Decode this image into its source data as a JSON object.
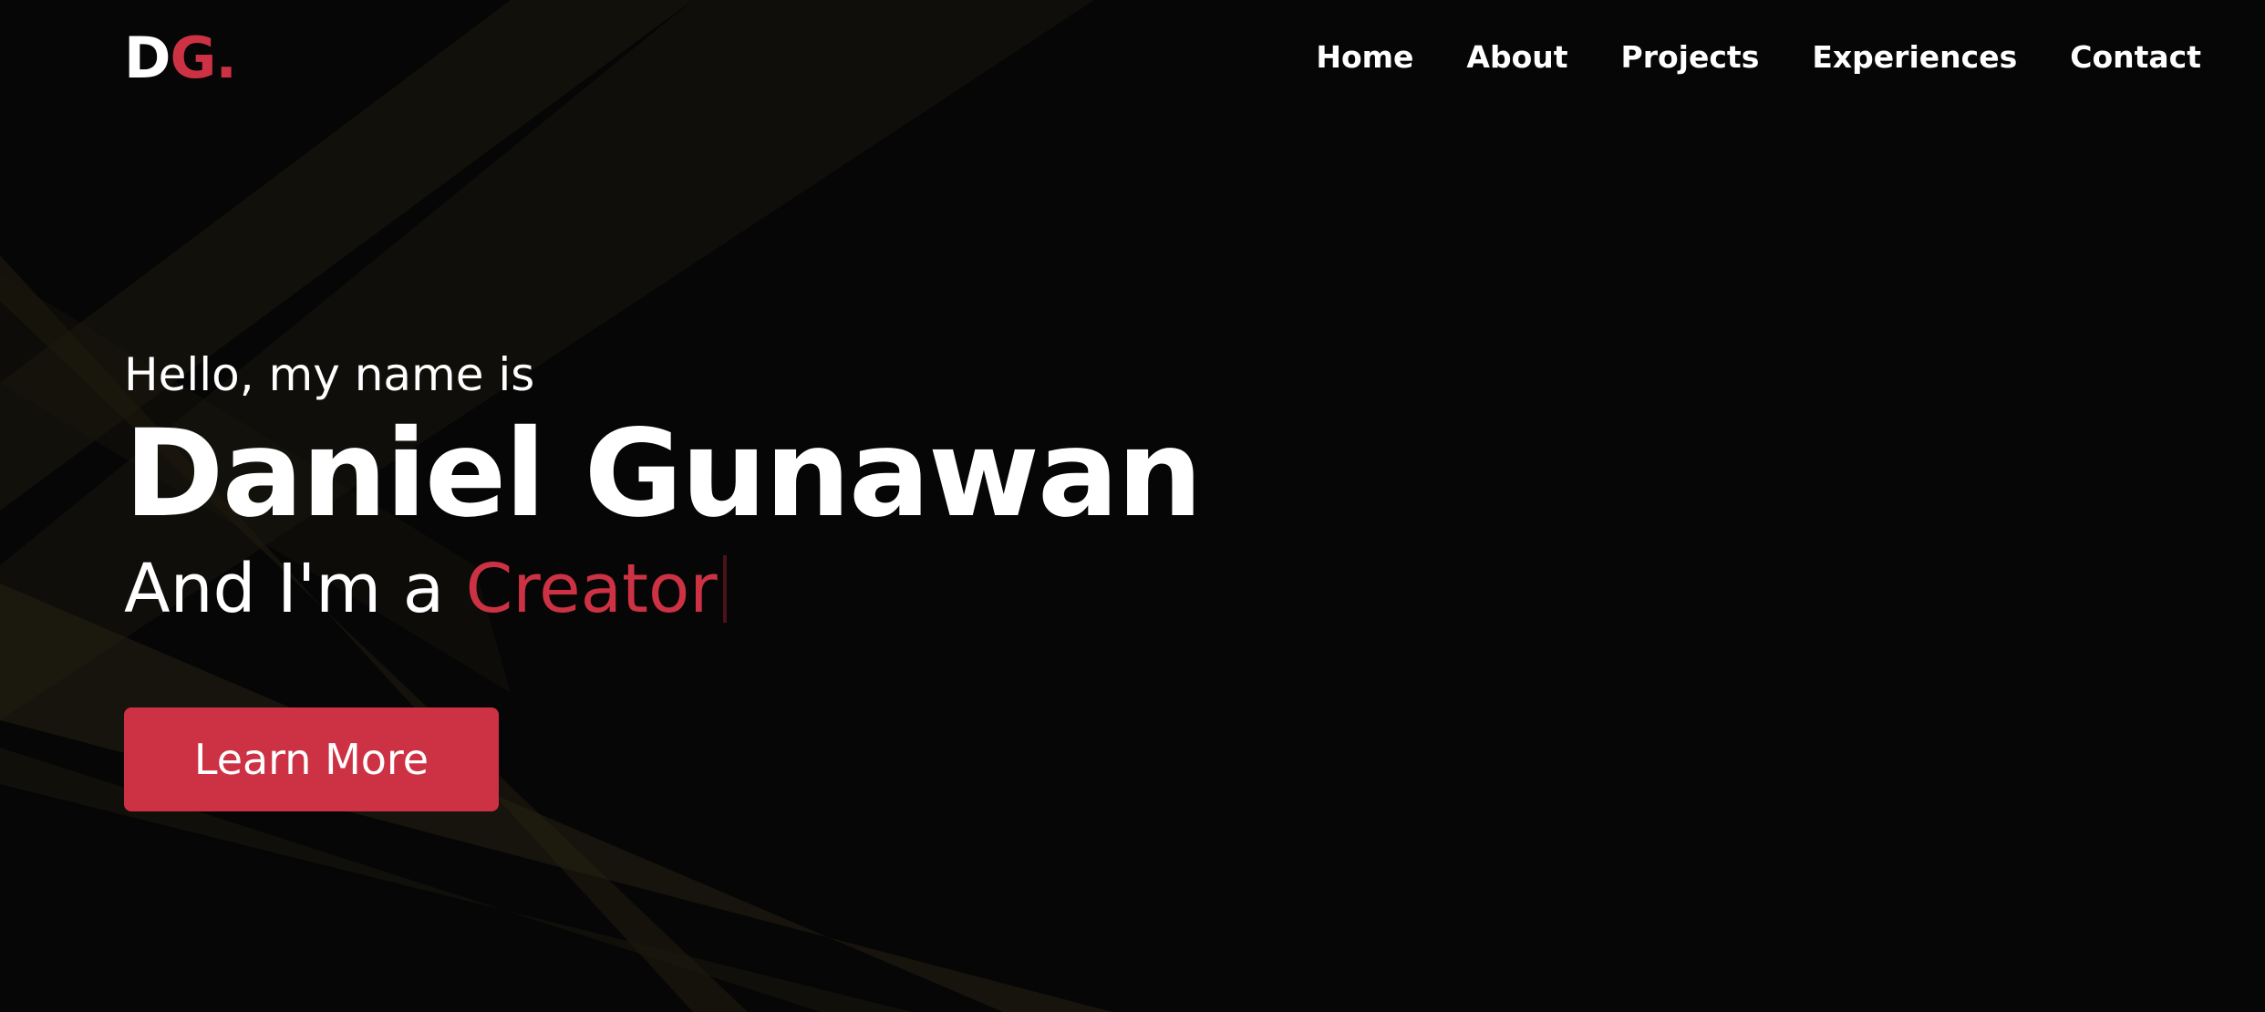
{
  "nav": {
    "logo_main": "D",
    "logo_accent": "G.",
    "items": [
      {
        "label": "Home"
      },
      {
        "label": "About"
      },
      {
        "label": "Projects"
      },
      {
        "label": "Experiences"
      },
      {
        "label": "Contact"
      }
    ]
  },
  "hero": {
    "greeting": "Hello, my name is",
    "name": "Daniel Gunawan",
    "role_prefix": "And I'm a",
    "role_word": "Creator",
    "button_label": "Learn More"
  },
  "colors": {
    "background": "#060606",
    "accent": "#cd3244",
    "text": "#ffffff",
    "beam": "#2a2412"
  }
}
